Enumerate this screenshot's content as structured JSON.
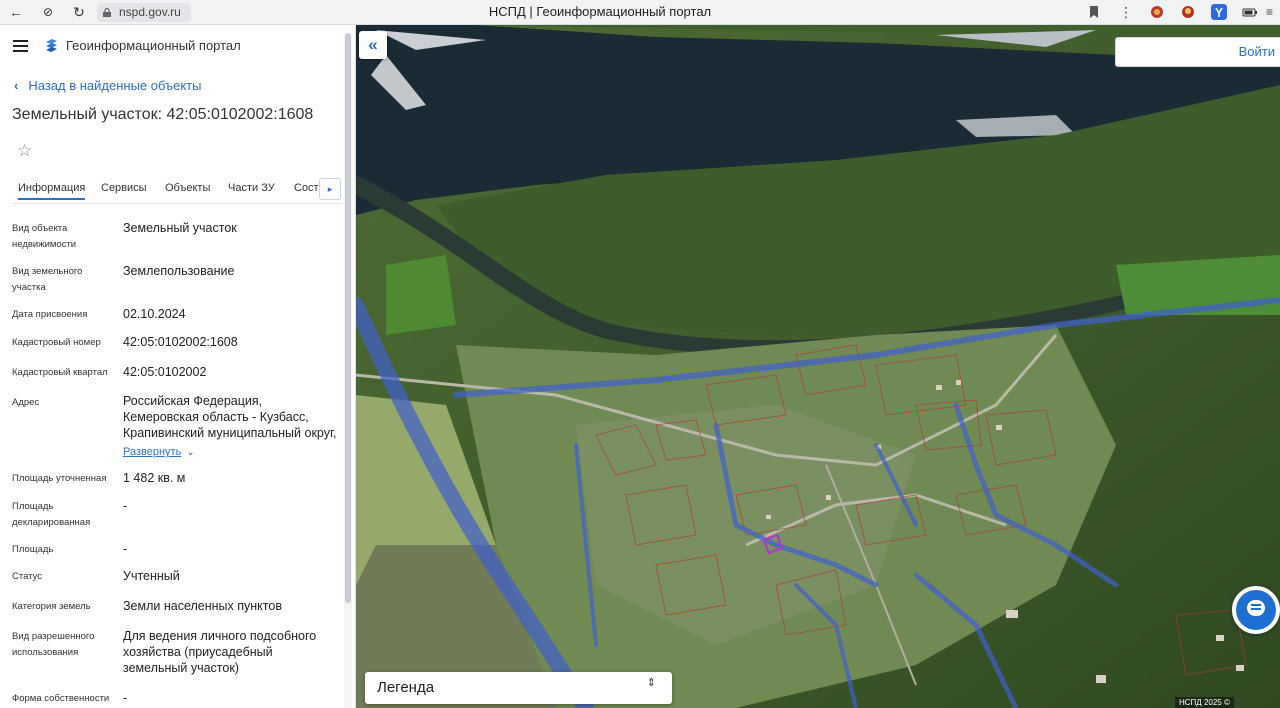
{
  "browser": {
    "address": "nspd.gov.ru",
    "window_title": "НСПД | Геоинформационный портал",
    "nav_back_icon": "←",
    "nav_reader_icon": "⊘",
    "nav_reload_icon": "↻"
  },
  "panel": {
    "portal_title": "Геоинформационный портал",
    "back_link": "Назад в найденные объекты",
    "object_title": "Земельный участок: 42:05:0102002:1608",
    "favorite_icon": "☆",
    "tabs": [
      {
        "label": "Информация",
        "active": true
      },
      {
        "label": "Сервисы",
        "active": false
      },
      {
        "label": "Объекты",
        "active": false
      },
      {
        "label": "Части ЗУ",
        "active": false
      },
      {
        "label": "Соста",
        "active": false
      }
    ],
    "tabs_more_icon": "▸",
    "fields": [
      {
        "label": "Вид объекта недвижимости",
        "value": "Земельный участок"
      },
      {
        "label": "Вид земельного участка",
        "value": "Землепользование"
      },
      {
        "label": "Дата присвоения",
        "value": "02.10.2024"
      },
      {
        "label": "Кадастровый номер",
        "value": "42:05:0102002:1608"
      },
      {
        "label": "Кадастровый квартал",
        "value": "42:05:0102002"
      },
      {
        "label": "Адрес",
        "value": "Российская Федерация, Кемеровская область - Кузбасс, Крапивинский муниципальный округ,"
      },
      {
        "label": "Площадь уточненная",
        "value": "1 482 кв. м"
      },
      {
        "label": "Площадь декларированная",
        "value": "-"
      },
      {
        "label": "Площадь",
        "value": "-"
      },
      {
        "label": "Статус",
        "value": "Учтенный"
      },
      {
        "label": "Категория земель",
        "value": "Земли населенных пунктов"
      },
      {
        "label": "Вид разрешенного использования",
        "value": "Для ведения личного подсобного хозяйства (приусадебный земельный участок)"
      },
      {
        "label": "Форма собственности",
        "value": "-"
      }
    ],
    "expand_label": "Развернуть",
    "expand_icon": "⌄"
  },
  "map": {
    "collapse_icon": "«",
    "login_label": "Войти",
    "legend_label": "Легенда",
    "legend_toggle_icon": "⇕",
    "copyright": "НСПД 2025 ©",
    "colors": {
      "forest": "#3c5a2a",
      "river": "#1b2a33",
      "field": "#8fa763",
      "boundary": "#3e5fcf",
      "parcel": "#b03a2e",
      "selected_parcel": "#b431d8"
    }
  }
}
